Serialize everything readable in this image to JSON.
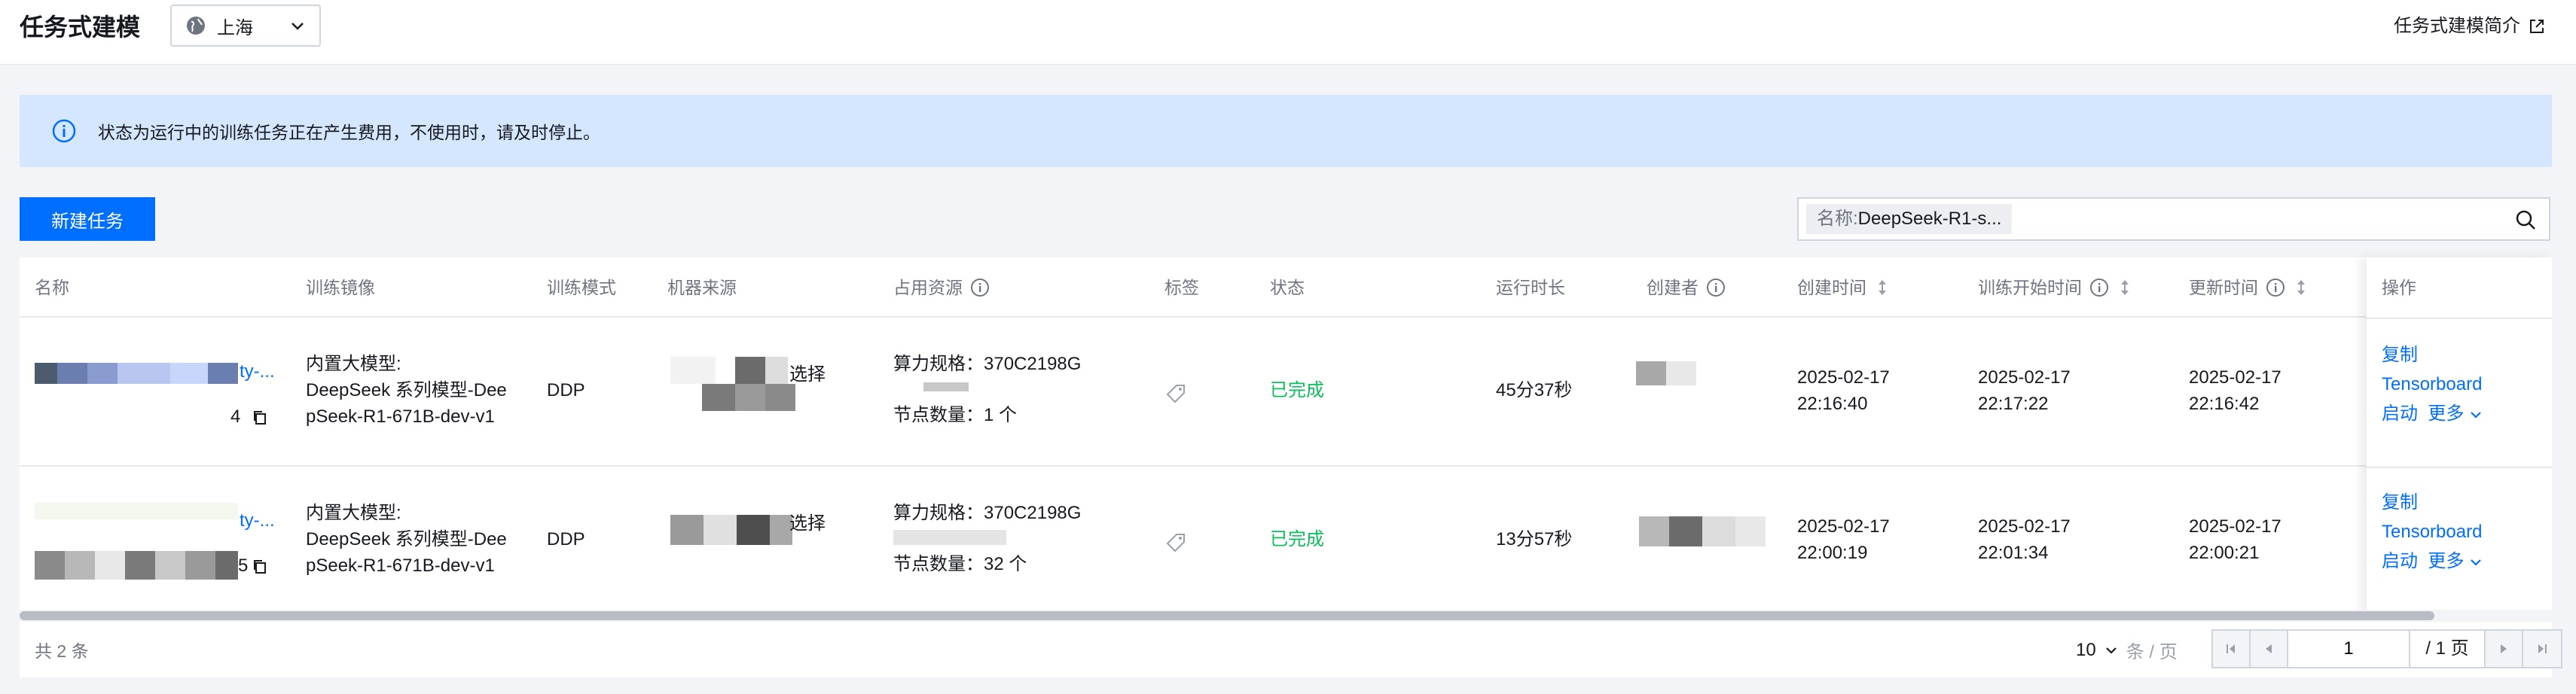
{
  "header": {
    "title": "任务式建模",
    "region": "上海",
    "intro_link": "任务式建模简介"
  },
  "notice": {
    "text": "状态为运行中的训练任务正在产生费用，不使用时，请及时停止。"
  },
  "toolbar": {
    "new_task_label": "新建任务",
    "search_key": "名称:",
    "search_value": "DeepSeek-R1-s..."
  },
  "table": {
    "headers": {
      "name": "名称",
      "image": "训练镜像",
      "mode": "训练模式",
      "machine": "机器来源",
      "resource": "占用资源",
      "tags": "标签",
      "status": "状态",
      "duration": "运行时长",
      "creator": "创建者",
      "created": "创建时间",
      "train_start": "训练开始时间",
      "updated": "更新时间",
      "ops": "操作"
    },
    "rows": [
      {
        "name_suffix": "ty-...",
        "id_tail": "4",
        "image_line1": "内置大模型:",
        "image_line2": "DeepSeek 系列模型-Dee",
        "image_line3": "pSeek-R1-671B-dev-v1",
        "mode": "DDP",
        "machine_tail": "选择",
        "resource_spec": "算力规格：370C2198G",
        "resource_nodes": "节点数量：1 个",
        "status": "已完成",
        "duration": "45分37秒",
        "created_date": "2025-02-17",
        "created_time": "22:16:40",
        "start_date": "2025-02-17",
        "start_time": "22:17:22",
        "updated_date": "2025-02-17",
        "updated_time": "22:16:42",
        "op_copy": "复制",
        "op_tensorboard": "Tensorboard",
        "op_start": "启动",
        "op_more": "更多"
      },
      {
        "name_suffix": "ty-...",
        "id_tail": "5",
        "image_line1": "内置大模型:",
        "image_line2": "DeepSeek 系列模型-Dee",
        "image_line3": "pSeek-R1-671B-dev-v1",
        "mode": "DDP",
        "machine_tail": "选择",
        "resource_spec": "算力规格：370C2198G",
        "resource_nodes": "节点数量：32 个",
        "status": "已完成",
        "duration": "13分57秒",
        "created_date": "2025-02-17",
        "created_time": "22:00:19",
        "start_date": "2025-02-17",
        "start_time": "22:01:34",
        "updated_date": "2025-02-17",
        "updated_time": "22:00:21",
        "op_copy": "复制",
        "op_tensorboard": "Tensorboard",
        "op_start": "启动",
        "op_more": "更多"
      }
    ]
  },
  "footer": {
    "total": "共 2 条",
    "page_size": "10",
    "page_unit": "条 / 页",
    "current_page": "1",
    "total_pages": "/ 1 页"
  },
  "colors": {
    "primary": "#006eff",
    "success": "#0abf5b",
    "notice_bg": "#d5e7ff"
  },
  "icons": [
    "globe-icon",
    "chevron-down-icon",
    "external-link-icon",
    "info-icon",
    "search-icon",
    "tag-icon",
    "copy-icon",
    "sort-icon",
    "first-page-icon",
    "prev-page-icon",
    "next-page-icon",
    "last-page-icon"
  ]
}
